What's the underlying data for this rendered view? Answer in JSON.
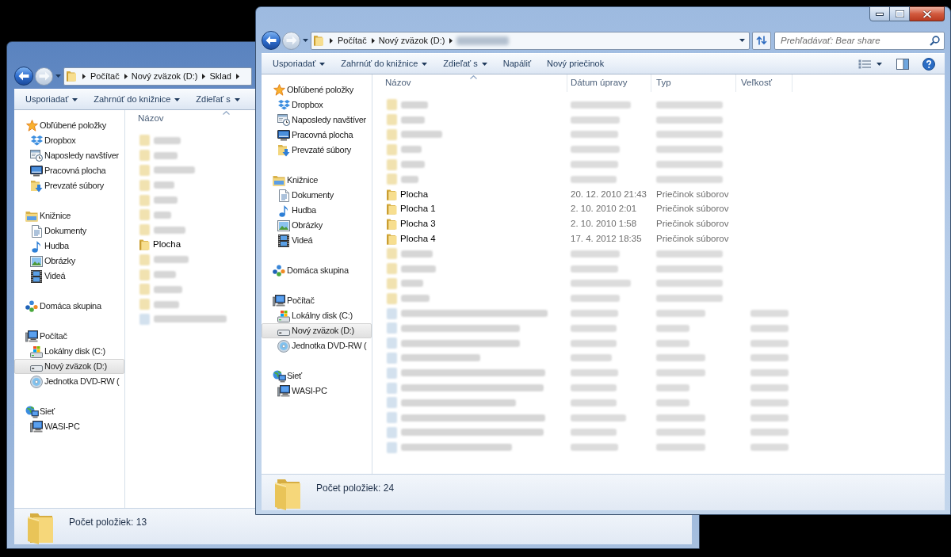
{
  "windows": [
    {
      "active": false,
      "navigation": {
        "back_disabled": false,
        "forward_disabled": true
      },
      "address": [
        {
          "kind": "text",
          "label": "Počítač"
        },
        {
          "kind": "text",
          "label": "Nový zväzok (D:)"
        },
        {
          "kind": "text",
          "label": "Sklad"
        }
      ],
      "toolbar": [
        {
          "label": "Usporiadať",
          "dropdown": true
        },
        {
          "label": "Zahrnúť do knižnice",
          "dropdown": true
        },
        {
          "label": "Zdieľať s",
          "dropdown": true
        }
      ],
      "sidebar": {
        "items": [
          {
            "label": "Obľúbené položky",
            "selected": false,
            "children": [
              {
                "label": "Dropbox",
                "selected": false
              },
              {
                "label": "Naposledy navštíver",
                "selected": false
              },
              {
                "label": "Pracovná plocha",
                "selected": false
              },
              {
                "label": "Prevzaté súbory",
                "selected": false
              }
            ]
          },
          {
            "label": "Knižnice",
            "selected": false,
            "children": [
              {
                "label": "Dokumenty",
                "selected": false
              },
              {
                "label": "Hudba",
                "selected": false
              },
              {
                "label": "Obrázky",
                "selected": false
              },
              {
                "label": "Videá",
                "selected": false
              }
            ]
          },
          {
            "label": "Domáca skupina",
            "selected": false
          },
          {
            "label": "Počítač",
            "selected": false,
            "children": [
              {
                "label": "Lokálny disk (C:)",
                "selected": false
              },
              {
                "label": "Nový zväzok (D:)",
                "selected": true
              },
              {
                "label": "Jednotka DVD-RW (",
                "selected": false
              }
            ]
          },
          {
            "label": "Sieť",
            "selected": false,
            "children": [
              {
                "label": "WASI-PC",
                "selected": false
              }
            ]
          }
        ]
      },
      "columns": [
        {
          "label": "Názov",
          "sorted": true
        }
      ],
      "rows": [
        {
          "kind": "blurred-folder",
          "selected": false
        },
        {
          "kind": "blurred-folder",
          "selected": false
        },
        {
          "kind": "blurred-folder",
          "selected": false
        },
        {
          "kind": "blurred-folder",
          "selected": false
        },
        {
          "kind": "blurred-folder",
          "selected": false
        },
        {
          "kind": "blurred-folder",
          "selected": false
        },
        {
          "kind": "blurred-folder",
          "selected": false
        },
        {
          "kind": "folder",
          "selected": false,
          "name": "Plocha"
        },
        {
          "kind": "blurred-folder",
          "selected": false
        },
        {
          "kind": "blurred-folder",
          "selected": false
        },
        {
          "kind": "blurred-folder",
          "selected": false
        },
        {
          "kind": "blurred-folder",
          "selected": false
        },
        {
          "kind": "blurred-file",
          "selected": false
        }
      ],
      "status_bar": {
        "item_count": "Počet položiek: 13"
      }
    },
    {
      "active": true,
      "navigation": {
        "back_disabled": false,
        "forward_disabled": true
      },
      "address": [
        {
          "kind": "text",
          "label": "Počítač"
        },
        {
          "kind": "text",
          "label": "Nový zväzok (D:)"
        },
        {
          "kind": "blurred"
        }
      ],
      "search": {
        "placeholder": "Prehľadávať: Bear share"
      },
      "toolbar": [
        {
          "label": "Usporiadať",
          "dropdown": true
        },
        {
          "label": "Zahrnúť do knižnice",
          "dropdown": true
        },
        {
          "label": "Zdieľať s",
          "dropdown": true
        },
        {
          "label": "Napáliť",
          "dropdown": false
        },
        {
          "label": "Nový priečinok",
          "dropdown": false
        }
      ],
      "sidebar": {
        "items": [
          {
            "label": "Obľúbené položky",
            "selected": false,
            "children": [
              {
                "label": "Dropbox",
                "selected": false
              },
              {
                "label": "Naposledy navštíver",
                "selected": false
              },
              {
                "label": "Pracovná plocha",
                "selected": false
              },
              {
                "label": "Prevzaté súbory",
                "selected": false
              }
            ]
          },
          {
            "label": "Knižnice",
            "selected": false,
            "children": [
              {
                "label": "Dokumenty",
                "selected": false
              },
              {
                "label": "Hudba",
                "selected": false
              },
              {
                "label": "Obrázky",
                "selected": false
              },
              {
                "label": "Videá",
                "selected": false
              }
            ]
          },
          {
            "label": "Domáca skupina",
            "selected": false
          },
          {
            "label": "Počítač",
            "selected": false,
            "children": [
              {
                "label": "Lokálny disk (C:)",
                "selected": false
              },
              {
                "label": "Nový zväzok (D:)",
                "selected": true
              },
              {
                "label": "Jednotka DVD-RW (",
                "selected": false
              }
            ]
          },
          {
            "label": "Sieť",
            "selected": false,
            "children": [
              {
                "label": "WASI-PC",
                "selected": false
              }
            ]
          }
        ]
      },
      "columns": [
        {
          "label": "Názov",
          "sorted": true
        },
        {
          "label": "Dátum úpravy",
          "sorted": false
        },
        {
          "label": "Typ",
          "sorted": false
        },
        {
          "label": "Veľkosť",
          "sorted": false
        }
      ],
      "rows": [
        {
          "kind": "blurred-folder",
          "selected": false
        },
        {
          "kind": "blurred-folder",
          "selected": false
        },
        {
          "kind": "blurred-folder",
          "selected": false
        },
        {
          "kind": "blurred-folder",
          "selected": false
        },
        {
          "kind": "blurred-folder",
          "selected": false
        },
        {
          "kind": "blurred-folder",
          "selected": false
        },
        {
          "kind": "folder",
          "selected": false,
          "name": "Plocha",
          "modified": "20. 12. 2010 21:43",
          "type": "Priečinok súborov"
        },
        {
          "kind": "folder",
          "selected": false,
          "name": "Plocha 1",
          "modified": "2. 10. 2010 2:01",
          "type": "Priečinok súborov"
        },
        {
          "kind": "folder",
          "selected": false,
          "name": "Plocha 3",
          "modified": "2. 10. 2010 1:58",
          "type": "Priečinok súborov"
        },
        {
          "kind": "folder",
          "selected": false,
          "name": "Plocha 4",
          "modified": "17. 4. 2012 18:35",
          "type": "Priečinok súborov"
        },
        {
          "kind": "blurred-folder",
          "selected": false
        },
        {
          "kind": "blurred-folder",
          "selected": false
        },
        {
          "kind": "blurred-folder",
          "selected": false
        },
        {
          "kind": "blurred-folder",
          "selected": false
        },
        {
          "kind": "blurred-file",
          "selected": false
        },
        {
          "kind": "blurred-file",
          "selected": false
        },
        {
          "kind": "blurred-file",
          "selected": false
        },
        {
          "kind": "blurred-file",
          "selected": false
        },
        {
          "kind": "blurred-file",
          "selected": false
        },
        {
          "kind": "blurred-file",
          "selected": false
        },
        {
          "kind": "blurred-file",
          "selected": false
        },
        {
          "kind": "blurred-file",
          "selected": false
        },
        {
          "kind": "blurred-file",
          "selected": false
        },
        {
          "kind": "blurred-file",
          "selected": false
        }
      ],
      "status_bar": {
        "item_count": "Počet položiek: 24"
      }
    }
  ]
}
